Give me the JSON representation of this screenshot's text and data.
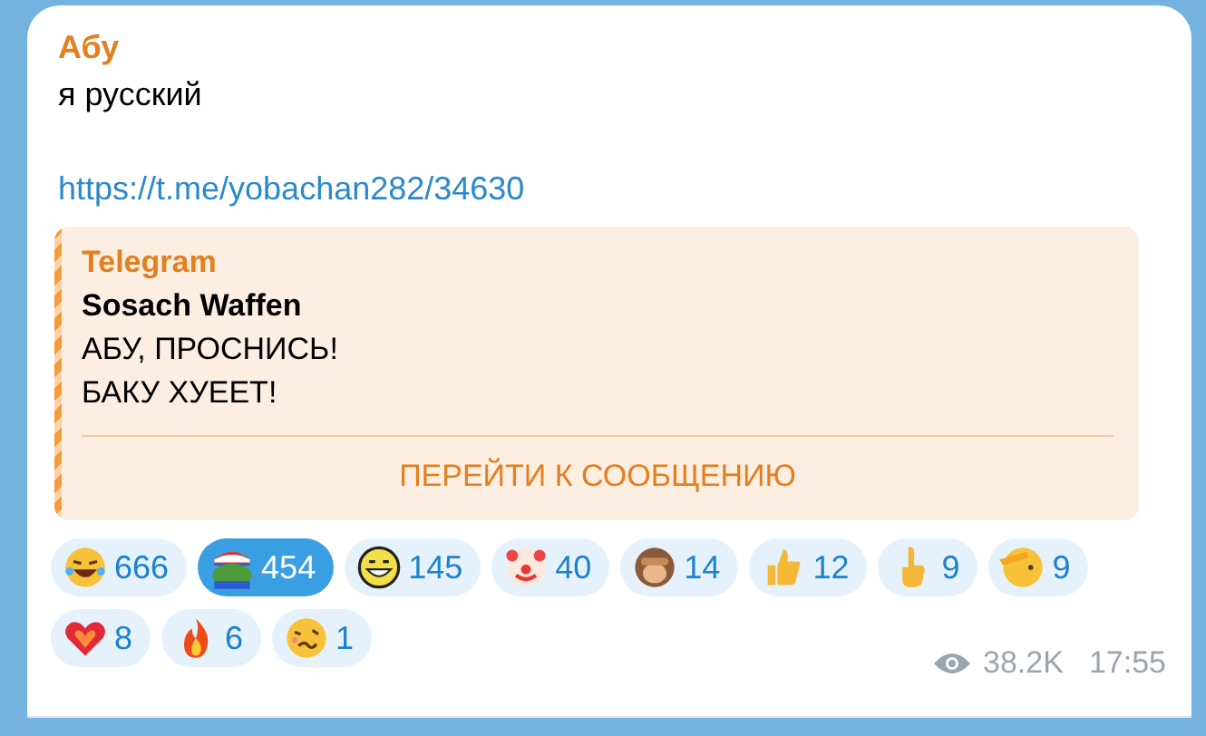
{
  "message": {
    "author": "Абу",
    "text": "я русский",
    "link": "https://t.me/yobachan282/34630",
    "quote": {
      "source": "Telegram",
      "title": "Sosach Waffen",
      "lines": [
        "АБУ, ПРОСНИСЬ!",
        "БАКУ ХУЕЕТ!"
      ],
      "action": "ПЕРЕЙТИ К СООБЩЕНИЮ"
    },
    "reactions": [
      {
        "count": "666",
        "selected": false
      },
      {
        "count": "454",
        "selected": true
      },
      {
        "count": "145",
        "selected": false
      },
      {
        "count": "40",
        "selected": false
      },
      {
        "count": "14",
        "selected": false
      },
      {
        "count": "12",
        "selected": false
      },
      {
        "count": "9",
        "selected": false
      },
      {
        "count": "9",
        "selected": false
      },
      {
        "count": "8",
        "selected": false
      },
      {
        "count": "6",
        "selected": false
      },
      {
        "count": "1",
        "selected": false
      }
    ],
    "views": "38.2K",
    "time": "17:55"
  }
}
